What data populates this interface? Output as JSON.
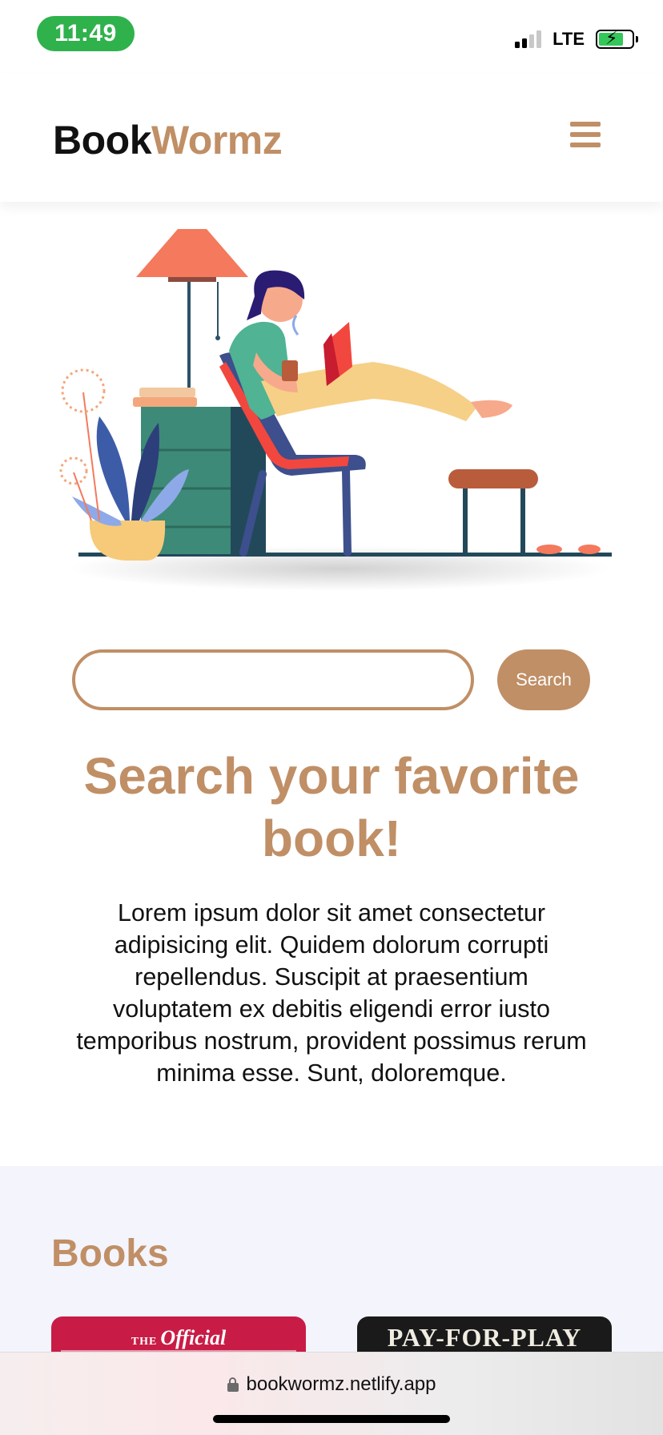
{
  "status_bar": {
    "time": "11:49",
    "network": "LTE",
    "signal_icon": "cellular-signal-icon",
    "battery_icon": "battery-charging-icon",
    "battery_color": "#34c759",
    "time_pill_color": "#2fb24c"
  },
  "header": {
    "brand_part1": "Book",
    "brand_part2": "Wormz",
    "menu_icon": "hamburger-menu-icon"
  },
  "hero": {
    "illustration": "woman-reading-illustration"
  },
  "search": {
    "input_value": "",
    "button_label": "Search"
  },
  "main": {
    "headline": "Search your favorite book!",
    "body": "Lorem ipsum dolor sit amet consectetur adipisicing elit. Quidem dolorum corrupti repellendus. Suscipit at praesentium voluptatem ex debitis eligendi error iusto temporibus nostrum, provident possimus rerum minima esse. Sunt, doloremque."
  },
  "books": {
    "title": "Books",
    "items": [
      {
        "cover_small": "THE",
        "cover_title": "Official",
        "color": "#c81c46"
      },
      {
        "cover_title": "PAY-FOR-PLAY",
        "color": "#1a1a1a"
      }
    ]
  },
  "browser": {
    "url": "bookwormz.netlify.app",
    "lock_icon": "lock-icon"
  },
  "colors": {
    "accent": "#c08f66",
    "section_bg": "#f3f4fc"
  }
}
